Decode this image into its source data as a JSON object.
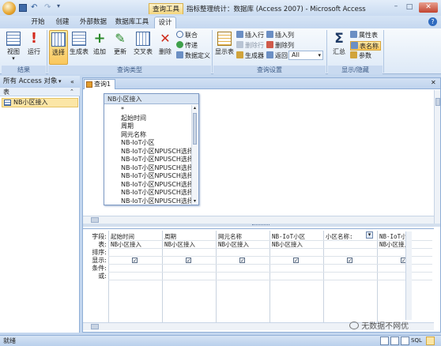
{
  "titlebar": {
    "title": "指标整理统计：数据库 (Access 2007) - Microsoft Access",
    "tool_context": "查询工具"
  },
  "ribbon_tabs": [
    {
      "label": "开始"
    },
    {
      "label": "创建"
    },
    {
      "label": "外部数据"
    },
    {
      "label": "数据库工具"
    },
    {
      "label": "设计",
      "active": true
    }
  ],
  "ribbon": {
    "groups": [
      {
        "label": "结果"
      },
      {
        "label": "查询类型"
      },
      {
        "label": "查询设置"
      },
      {
        "label": "显示/隐藏"
      }
    ],
    "results": {
      "view": "视图",
      "run": "运行"
    },
    "query_type": {
      "select": "选择",
      "make_table": "生成表",
      "append": "追加",
      "update": "更新",
      "crosstab": "交叉表",
      "delete": "删除",
      "union": "联合",
      "pass_through": "传递",
      "data_definition": "数据定义"
    },
    "query_setup": {
      "show_table": "显示表",
      "insert_rows": "插入行",
      "delete_rows": "删除行",
      "builder": "生成器",
      "insert_columns": "插入列",
      "delete_columns": "删除列",
      "return_label": "返回:",
      "return_value": "All"
    },
    "show_hide": {
      "totals": "汇总",
      "property_sheet": "属性表",
      "table_names": "表名称",
      "parameters": "参数"
    }
  },
  "nav": {
    "header": "所有 Access 对象",
    "section": "表",
    "items": [
      {
        "label": "NB小区接入"
      }
    ]
  },
  "doc_tab": "查询1",
  "table_box": {
    "title": "NB小区接入",
    "fields": [
      "*",
      "起始时间",
      "周期",
      "网元名称",
      "NB-IoT小区",
      "NB-IoT小区NPUSCH选择|",
      "NB-IoT小区NPUSCH选择|",
      "NB-IoT小区NPUSCH选择|",
      "NB-IoT小区NPUSCH选择|",
      "NB-IoT小区NPUSCH选择|",
      "NB-IoT小区NPUSCH选择|",
      "NB-IoT小区NPUSCH选择|"
    ]
  },
  "grid": {
    "row_labels": [
      "字段:",
      "表:",
      "排序:",
      "显示:",
      "条件:",
      "或:"
    ],
    "columns": [
      {
        "field": "起始时间",
        "table": "NB小区接入",
        "show": true
      },
      {
        "field": "周期",
        "table": "NB小区接入",
        "show": true
      },
      {
        "field": "网元名称",
        "table": "NB小区接入",
        "show": true
      },
      {
        "field": "NB-IoT小区",
        "table": "NB小区接入",
        "show": true
      },
      {
        "field": "小区名称:",
        "table": "",
        "show": true
      },
      {
        "field": "NB-IoT小区NPUSCH选",
        "table": "NB小区接入",
        "show": true
      }
    ]
  },
  "status": {
    "left": "就绪",
    "view_modes": [
      "数据表视图",
      "数据透视表",
      "数据透视图",
      "SQL",
      "设计视图"
    ]
  },
  "watermark": "无数据不网优"
}
